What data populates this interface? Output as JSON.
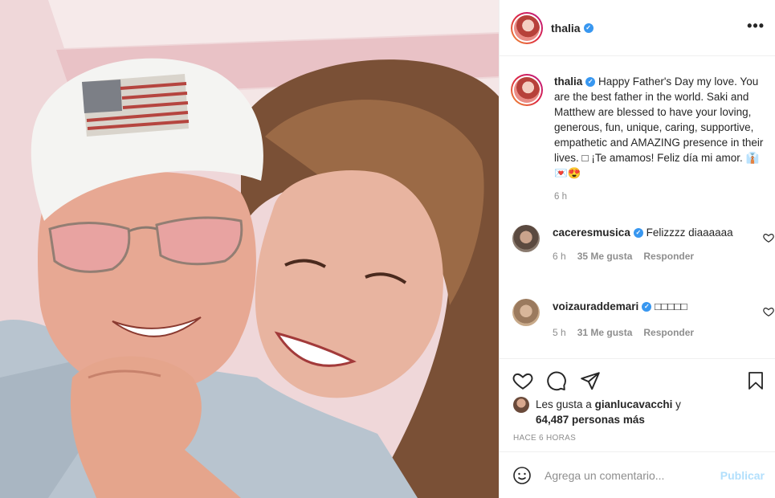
{
  "post": {
    "username": "thalia",
    "more_label": "•••"
  },
  "caption": {
    "username": "thalia",
    "text": "Happy Father's Day my love. You are the best father in the world. Saki and Matthew are blessed to have your loving, generous, fun, unique, caring, supportive, empathetic and AMAZING presence in their lives. □ ¡Te amamos! Feliz día mi amor. 👔💌😍",
    "time": "6 h"
  },
  "comments": [
    {
      "username": "caceresmusica",
      "text": "Felizzzz diaaaaaa",
      "time": "6 h",
      "likes": "35 Me gusta",
      "reply": "Responder"
    },
    {
      "username": "voizauraddemari",
      "text": "□□□□□",
      "time": "5 h",
      "likes": "31 Me gusta",
      "reply": "Responder"
    }
  ],
  "likes": {
    "prefix": "Les gusta a",
    "user": "gianlucavacchi",
    "suffix": "y",
    "count": "64,487 personas más"
  },
  "timestamp": "HACE 6 HORAS",
  "add_comment": {
    "placeholder": "Agrega un comentario...",
    "publish": "Publicar"
  },
  "icons": {
    "like": "heart-icon",
    "comment": "comment-icon",
    "share": "paper-plane-icon",
    "save": "bookmark-icon",
    "emoji": "smiley-icon"
  },
  "colors": {
    "verified": "#3897f0",
    "publish_disabled": "#b2dffc",
    "secondary_text": "#8e8e8e"
  }
}
